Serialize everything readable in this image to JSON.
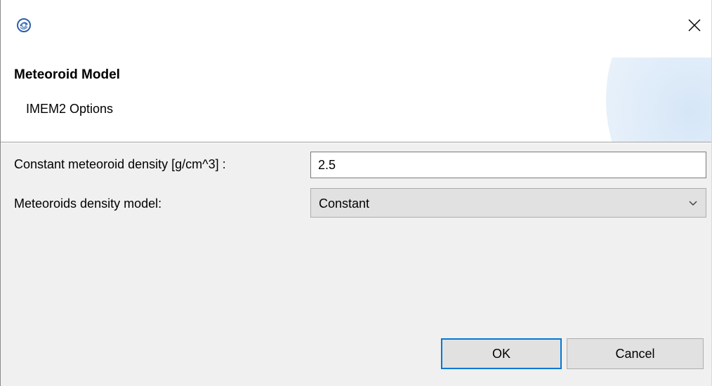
{
  "window": {
    "app_icon": "eclipse-style-app-icon",
    "close_icon": "close-x-icon"
  },
  "header": {
    "title": "Meteoroid Model",
    "subtitle": "IMEM2 Options"
  },
  "form": {
    "density_label": "Constant meteoroid density [g/cm^3] :",
    "density_value": "2.5",
    "model_label": "Meteoroids density model:",
    "model_selected": "Constant",
    "model_chevron_icon": "chevron-down-icon"
  },
  "buttons": {
    "ok_label": "OK",
    "cancel_label": "Cancel"
  },
  "colors": {
    "accent": "#0078d7",
    "background": "#f0f0f0",
    "header_background": "#ffffff"
  }
}
